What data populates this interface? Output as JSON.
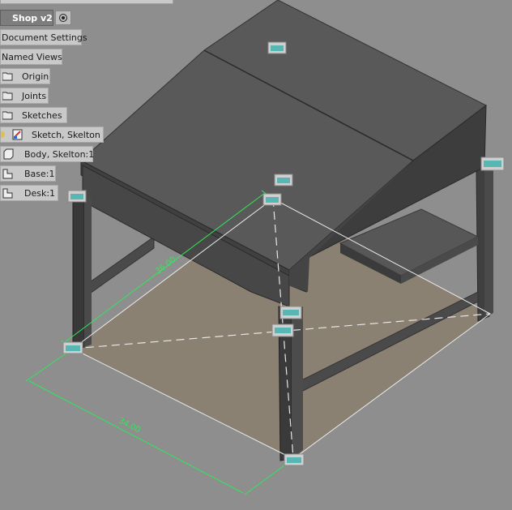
{
  "browser": {
    "header": "Shop v2",
    "items": [
      {
        "label": "Document Settings",
        "icon": "none"
      },
      {
        "label": "Named Views",
        "icon": "none"
      },
      {
        "label": "Origin",
        "icon": "folder-icon"
      },
      {
        "label": "Joints",
        "icon": "folder-icon"
      },
      {
        "label": "Sketches",
        "icon": "folder-icon"
      },
      {
        "label": "Sketch, Skelton",
        "icon": "sketch-icon"
      },
      {
        "label": "Body, Skelton:1",
        "icon": "body-icon"
      },
      {
        "label": "Base:1",
        "icon": "component-icon"
      },
      {
        "label": "Desk:1",
        "icon": "component-icon"
      }
    ]
  },
  "dimensions": {
    "depth": "36.00",
    "width": "34.00"
  },
  "colors": {
    "background": "#8e8e8e",
    "dimension_line": "#2ee85a",
    "desk_top": "#5c5c5c",
    "desk_side": "#3e3e3e",
    "floor_sketch": "#8a7f70",
    "joint_glyph": "#58b7b3"
  }
}
